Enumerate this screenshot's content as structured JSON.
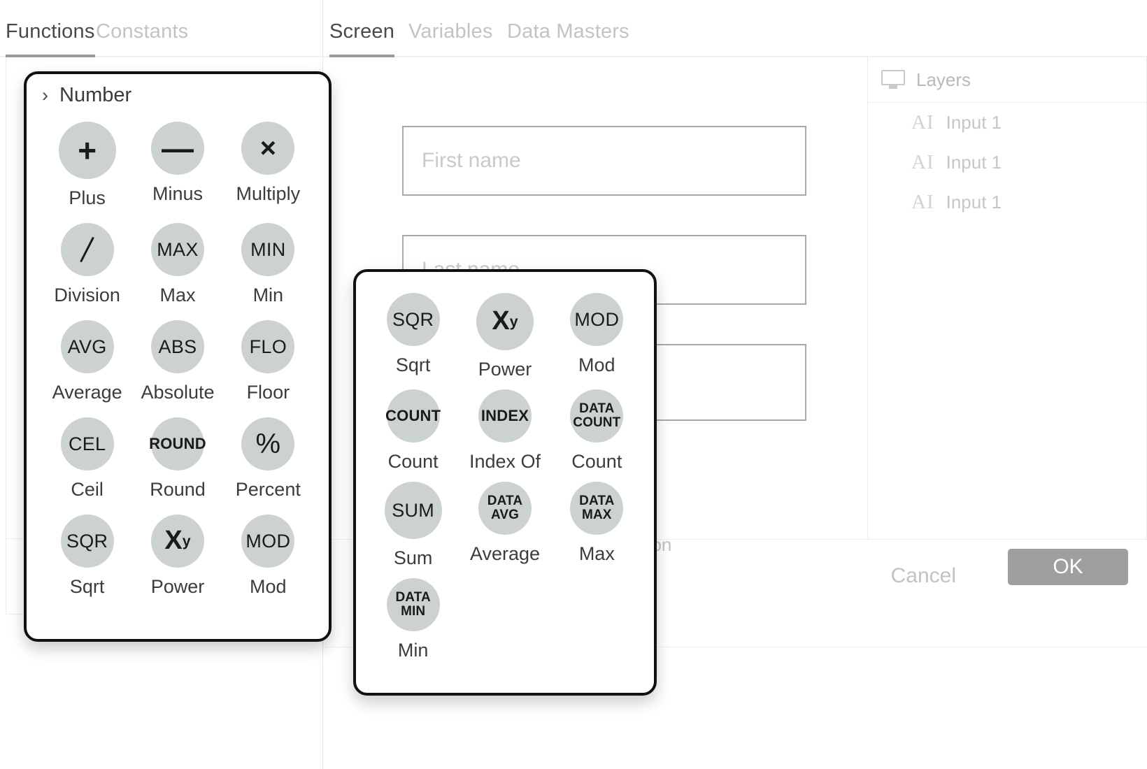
{
  "left_panel": {
    "tabs": [
      {
        "label": "Functions",
        "active": true
      },
      {
        "label": "Constants",
        "active": false
      }
    ]
  },
  "main_panel": {
    "tabs": [
      {
        "label": "Screen",
        "active": true
      },
      {
        "label": "Variables",
        "active": false
      },
      {
        "label": "Data Masters",
        "active": false
      }
    ]
  },
  "canvas": {
    "fields": [
      {
        "placeholder": "First name",
        "value": ""
      },
      {
        "placeholder": "Last name",
        "value": ""
      },
      {
        "placeholder": "",
        "value": ""
      }
    ],
    "occluded_label": "bon"
  },
  "layers": {
    "icon": "monitor-icon",
    "title": "Layers",
    "items": [
      {
        "icon": "text-input-icon",
        "icon_glyph": "AI",
        "label": "Input 1"
      },
      {
        "icon": "text-input-icon",
        "icon_glyph": "AI",
        "label": "Input 1"
      },
      {
        "icon": "text-input-icon",
        "icon_glyph": "AI",
        "label": "Input 1"
      }
    ]
  },
  "footer": {
    "cancel_label": "Cancel",
    "ok_label": "OK",
    "ok_bg": "#9f9f9f"
  },
  "popover_number": {
    "header": {
      "chevron": "›",
      "title": "Number"
    },
    "items": [
      {
        "glyph": "+",
        "glyph_style": "g-sym",
        "size": "sz-lg",
        "label": "Plus",
        "icon_name": "plus-icon"
      },
      {
        "glyph": "—",
        "glyph_style": "g-sym",
        "size": "sz-md",
        "label": "Minus",
        "icon_name": "minus-icon"
      },
      {
        "glyph": "×",
        "glyph_style": "g-sym-x",
        "size": "sz-md",
        "label": "Multiply",
        "icon_name": "multiply-icon"
      },
      {
        "glyph": "",
        "glyph_style": "g-slash",
        "size": "sz-md",
        "label": "Division",
        "icon_name": "division-icon"
      },
      {
        "glyph": "MAX",
        "glyph_style": "g-abbr",
        "size": "sz-md",
        "label": "Max",
        "icon_name": "max-icon"
      },
      {
        "glyph": "MIN",
        "glyph_style": "g-abbr",
        "size": "sz-md",
        "label": "Min",
        "icon_name": "min-icon"
      },
      {
        "glyph": "AVG",
        "glyph_style": "g-abbr",
        "size": "sz-md",
        "label": "Average",
        "icon_name": "average-icon"
      },
      {
        "glyph": "ABS",
        "glyph_style": "g-abbr",
        "size": "sz-md",
        "label": "Absolute",
        "icon_name": "absolute-icon"
      },
      {
        "glyph": "FLO",
        "glyph_style": "g-abbr",
        "size": "sz-md",
        "label": "Floor",
        "icon_name": "floor-icon"
      },
      {
        "glyph": "CEL",
        "glyph_style": "g-abbr",
        "size": "sz-md",
        "label": "Ceil",
        "icon_name": "ceil-icon"
      },
      {
        "glyph": "ROUND",
        "glyph_style": "g-abbr-sm",
        "size": "sz-md",
        "label": "Round",
        "icon_name": "round-icon"
      },
      {
        "glyph": "%",
        "glyph_style": "g-pct",
        "size": "sz-md",
        "label": "Percent",
        "icon_name": "percent-icon"
      },
      {
        "glyph": "SQR",
        "glyph_style": "g-abbr",
        "size": "sz-md",
        "label": "Sqrt",
        "icon_name": "sqrt-icon"
      },
      {
        "glyph": "Xʸ",
        "glyph_style": "g-pow",
        "size": "sz-md",
        "label": "Power",
        "icon_name": "power-icon"
      },
      {
        "glyph": "MOD",
        "glyph_style": "g-abbr",
        "size": "sz-md",
        "label": "Mod",
        "icon_name": "mod-icon"
      }
    ]
  },
  "popover_more": {
    "items": [
      {
        "glyph": "SQR",
        "glyph_style": "g-abbr",
        "size": "sz-md",
        "label": "Sqrt",
        "icon_name": "sqrt-icon"
      },
      {
        "glyph": "Xʸ",
        "glyph_style": "g-pow",
        "size": "sz-lg",
        "label": "Power",
        "icon_name": "power-icon"
      },
      {
        "glyph": "MOD",
        "glyph_style": "g-abbr",
        "size": "sz-md",
        "label": "Mod",
        "icon_name": "mod-icon"
      },
      {
        "glyph": "COUNT",
        "glyph_style": "g-abbr-sm",
        "size": "sz-md",
        "label": "Count",
        "icon_name": "count-icon"
      },
      {
        "glyph": "INDEX",
        "glyph_style": "g-abbr-sm",
        "size": "sz-md",
        "label": "Index Of",
        "icon_name": "index-of-icon"
      },
      {
        "glyph": "DATA COUNT",
        "glyph_style": "g-abbr-xs",
        "size": "sz-md",
        "label": "Count",
        "icon_name": "data-count-icon"
      },
      {
        "glyph": "SUM",
        "glyph_style": "g-abbr",
        "size": "sz-lg",
        "label": "Sum",
        "icon_name": "sum-icon"
      },
      {
        "glyph": "DATA AVG",
        "glyph_style": "g-abbr-xs",
        "size": "sz-md",
        "label": "Average",
        "icon_name": "data-avg-icon"
      },
      {
        "glyph": "DATA MAX",
        "glyph_style": "g-abbr-xs",
        "size": "sz-md",
        "label": "Max",
        "icon_name": "data-max-icon"
      },
      {
        "glyph": "DATA MIN",
        "glyph_style": "g-abbr-xs",
        "size": "sz-md",
        "label": "Min",
        "icon_name": "data-min-icon"
      }
    ]
  }
}
